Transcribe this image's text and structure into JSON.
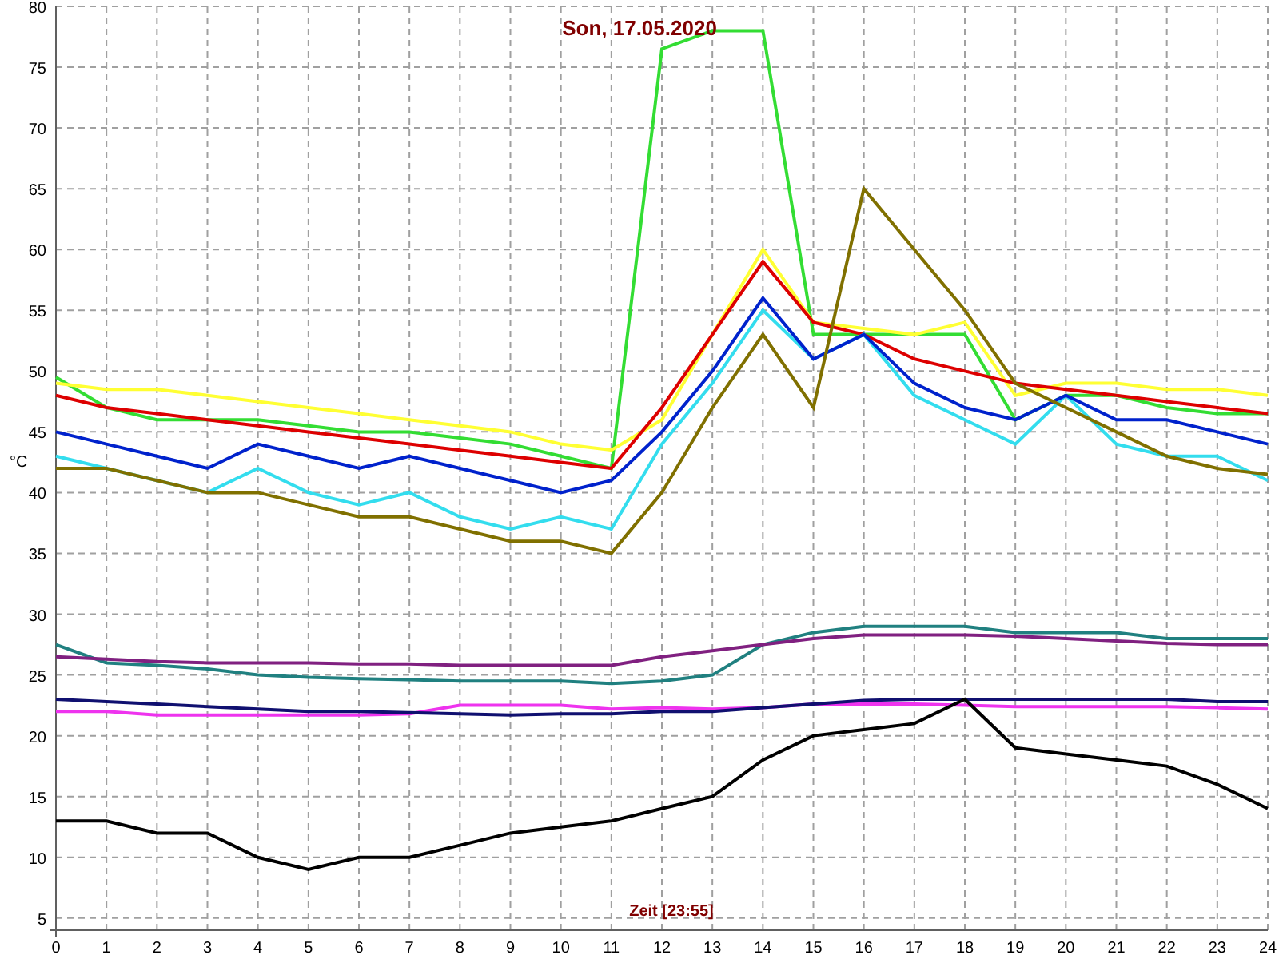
{
  "chart": {
    "chart_data": {
      "type": "line",
      "title": "Son, 17.05.2020",
      "xlabel": "Zeit [23:55]",
      "ylabel": "°C",
      "x": [
        0,
        1,
        2,
        3,
        4,
        5,
        6,
        7,
        8,
        9,
        10,
        11,
        12,
        13,
        14,
        15,
        16,
        17,
        18,
        19,
        20,
        21,
        22,
        23,
        24
      ],
      "xlim": [
        0,
        24
      ],
      "grid": true,
      "ylim": [
        4,
        80
      ],
      "xticks": [
        0,
        1,
        2,
        3,
        4,
        5,
        6,
        7,
        8,
        9,
        10,
        11,
        12,
        13,
        14,
        15,
        16,
        17,
        18,
        19,
        20,
        21,
        22,
        23,
        24
      ],
      "yticks": [
        5,
        10,
        15,
        20,
        25,
        30,
        35,
        40,
        45,
        50,
        55,
        60,
        65,
        70,
        75,
        80
      ],
      "series": [
        {
          "color": "#33dd33",
          "values": [
            49.5,
            47,
            46,
            46,
            46,
            45.5,
            45,
            45,
            44.5,
            44,
            43,
            42,
            76.5,
            78,
            78,
            53,
            53,
            53,
            53,
            46,
            48,
            48,
            47,
            46.5,
            46.5
          ]
        },
        {
          "color": "#ffff33",
          "values": [
            49,
            48.5,
            48.5,
            48,
            47.5,
            47,
            46.5,
            46,
            45.5,
            45,
            44,
            43.5,
            46,
            53,
            60,
            54,
            53.5,
            53,
            54,
            48,
            49,
            49,
            48.5,
            48.5,
            48
          ]
        },
        {
          "color": "#dd0000",
          "values": [
            48,
            47,
            46.5,
            46,
            45.5,
            45,
            44.5,
            44,
            43.5,
            43,
            42.5,
            42,
            47,
            53,
            59,
            54,
            53,
            51,
            50,
            49,
            48.5,
            48,
            47.5,
            47,
            46.5
          ]
        },
        {
          "color": "#33ddee",
          "values": [
            43,
            42,
            41,
            40,
            42,
            40,
            39,
            40,
            38,
            37,
            38,
            37,
            44,
            49,
            55,
            51,
            53,
            48,
            46,
            44,
            48,
            44,
            43,
            43,
            41
          ]
        },
        {
          "color": "#0022cc",
          "values": [
            45,
            44,
            43,
            42,
            44,
            43,
            42,
            43,
            42,
            41,
            40,
            41,
            45,
            50,
            56,
            51,
            53,
            49,
            47,
            46,
            48,
            46,
            46,
            45,
            44
          ]
        },
        {
          "color": "#807000",
          "values": [
            42,
            42,
            41,
            40,
            40,
            39,
            38,
            38,
            37,
            36,
            36,
            35,
            40,
            47,
            53,
            47,
            65,
            60,
            55,
            49,
            47,
            45,
            43,
            42,
            41.5
          ]
        },
        {
          "color": "#208080",
          "values": [
            27.5,
            26,
            25.8,
            25.5,
            25,
            24.8,
            24.7,
            24.6,
            24.5,
            24.5,
            24.5,
            24.3,
            24.5,
            25,
            27.5,
            28.5,
            29,
            29,
            29,
            28.5,
            28.5,
            28.5,
            28,
            28,
            28
          ]
        },
        {
          "color": "#802080",
          "values": [
            26.5,
            26.3,
            26.1,
            26,
            26,
            26,
            25.9,
            25.9,
            25.8,
            25.8,
            25.8,
            25.8,
            26.5,
            27,
            27.5,
            28,
            28.3,
            28.3,
            28.3,
            28.2,
            28,
            27.8,
            27.6,
            27.5,
            27.5
          ]
        },
        {
          "color": "#ee33ee",
          "values": [
            22,
            22,
            21.7,
            21.7,
            21.7,
            21.7,
            21.7,
            21.8,
            22.5,
            22.5,
            22.5,
            22.2,
            22.3,
            22.2,
            22.3,
            22.6,
            22.6,
            22.6,
            22.5,
            22.4,
            22.4,
            22.4,
            22.4,
            22.3,
            22.2
          ]
        },
        {
          "color": "#101070",
          "values": [
            23,
            22.8,
            22.6,
            22.4,
            22.2,
            22,
            22,
            21.9,
            21.8,
            21.7,
            21.8,
            21.8,
            22,
            22,
            22.3,
            22.6,
            22.9,
            23,
            23,
            23,
            23,
            23,
            23,
            22.8,
            22.8
          ]
        },
        {
          "color": "#000000",
          "values": [
            13,
            13,
            12,
            12,
            10,
            9,
            10,
            10,
            11,
            12,
            12.5,
            13,
            14,
            15,
            18,
            20,
            20.5,
            21,
            23,
            19,
            18.5,
            18,
            17.5,
            16,
            14
          ]
        }
      ]
    }
  }
}
